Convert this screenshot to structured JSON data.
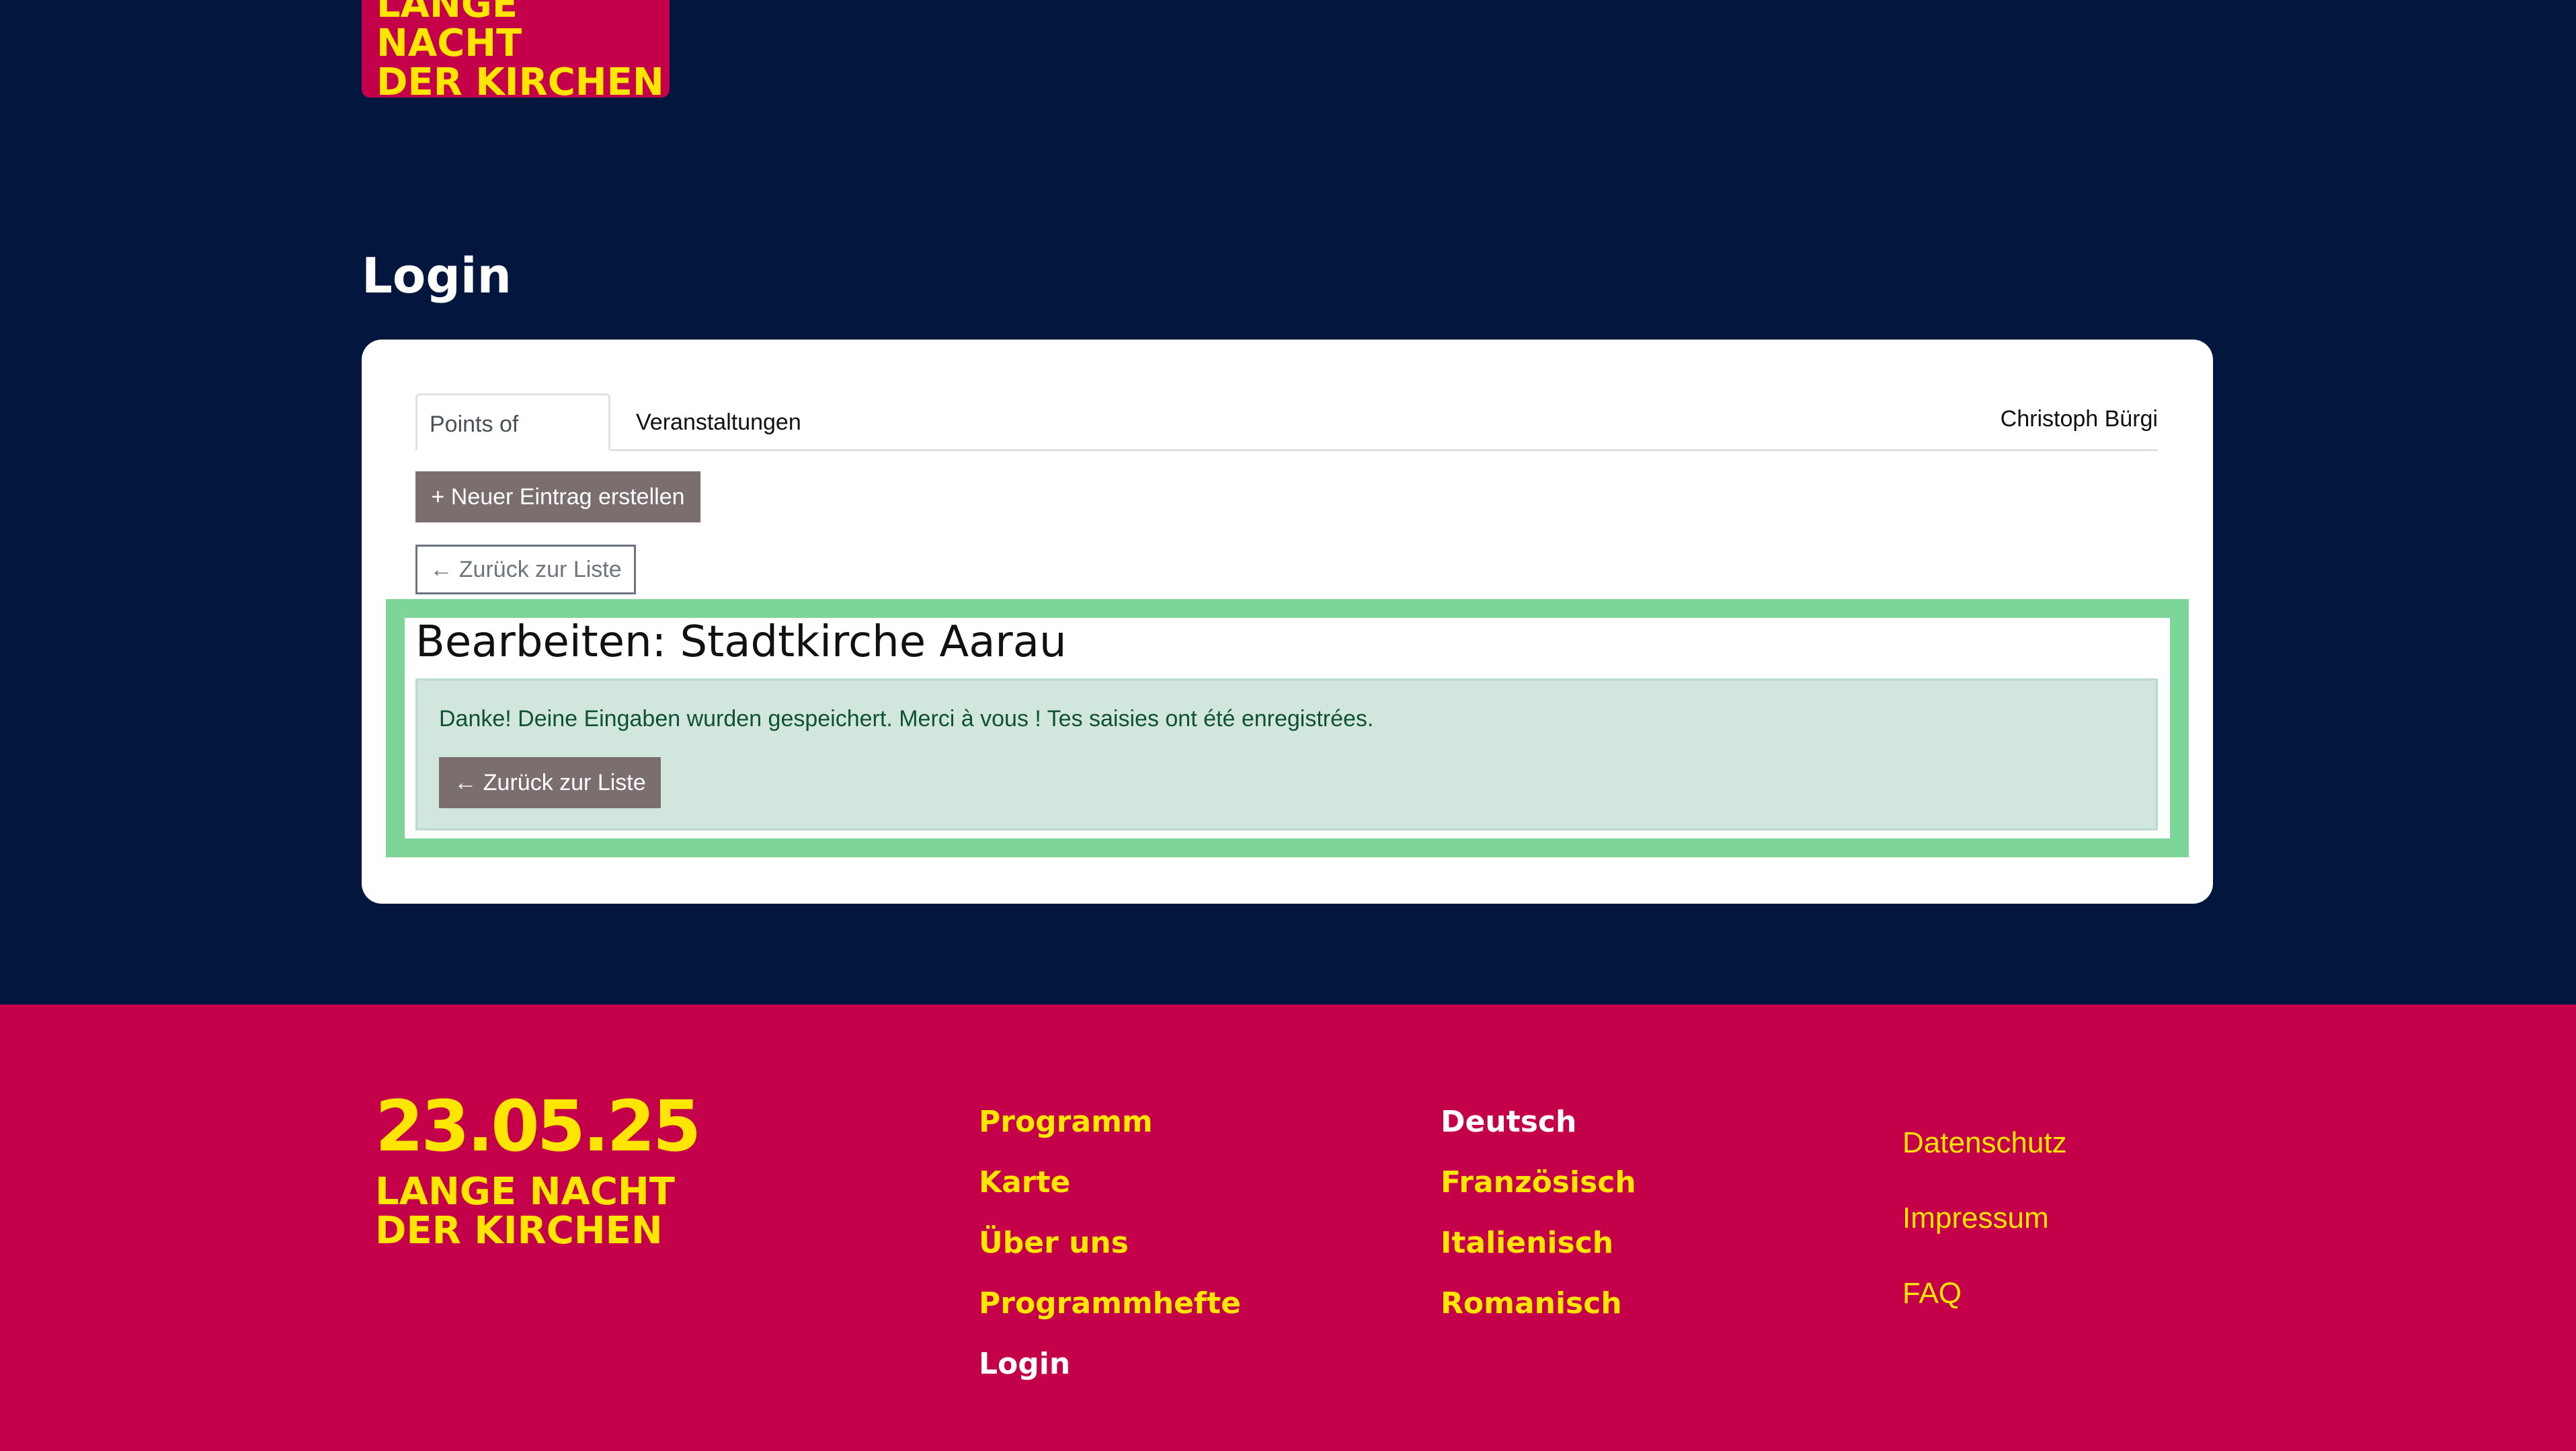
{
  "brand": {
    "logo_line1": "LANGE NACHT",
    "logo_line2": "DER KIRCHEN",
    "footer_date": "23.05.25"
  },
  "page": {
    "title": "Login"
  },
  "tabs": [
    {
      "label": "Points of Interest",
      "active": true
    },
    {
      "label": "Veranstaltungen",
      "active": false
    }
  ],
  "user": {
    "name": "Christoph Bürgi"
  },
  "actions": {
    "new_entry": "+ Neuer Eintrag erstellen",
    "back_to_list": "← Zurück zur Liste"
  },
  "edit": {
    "heading": "Bearbeiten: Stadtkirche Aarau",
    "success_message": "Danke! Deine Eingaben wurden gespeichert. Merci à vous ! Tes saisies ont été enregistrées.",
    "back_button": "← Zurück zur Liste"
  },
  "footer": {
    "nav": [
      "Programm",
      "Karte",
      "Über uns",
      "Programmhefte",
      "Login"
    ],
    "languages": [
      "Deutsch",
      "Französisch",
      "Italienisch",
      "Romanisch"
    ],
    "legal": [
      "Datenschutz",
      "Impressum",
      "FAQ"
    ]
  },
  "colors": {
    "navy": "#02163e",
    "magenta": "#c5004a",
    "yellow": "#ffe600",
    "highlight_green": "#7dd59a",
    "alert_bg": "#d1e7dd"
  }
}
